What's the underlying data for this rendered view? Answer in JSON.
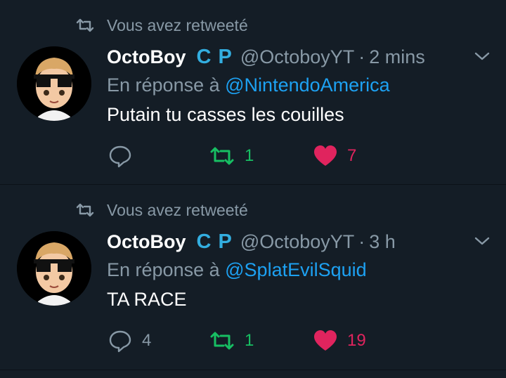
{
  "colors": {
    "background": "#141d26",
    "secondary_text": "#8899a6",
    "mention": "#1da1f2",
    "badge": "#33aee0",
    "retweet": "#17bf63",
    "like": "#e0245e"
  },
  "tweets": [
    {
      "retweet_context": "Vous avez retweeté",
      "author_name": "OctoBoy",
      "badge_c": "C",
      "badge_p": "P",
      "handle": "@OctoboyYT",
      "separator": "·",
      "time": "2 mins",
      "reply_prefix": "En réponse à",
      "reply_to": "@NintendoAmerica",
      "text": "Putain tu casses les couilles",
      "reply_count": "",
      "retweet_count": "1",
      "like_count": "7",
      "icons": [
        "retweet-icon",
        "avatar",
        "chevron-down-icon",
        "reply-icon",
        "retweet-icon",
        "heart-icon"
      ]
    },
    {
      "retweet_context": "Vous avez retweeté",
      "author_name": "OctoBoy",
      "badge_c": "C",
      "badge_p": "P",
      "handle": "@OctoboyYT",
      "separator": "·",
      "time": "3 h",
      "reply_prefix": "En réponse à",
      "reply_to": "@SplatEvilSquid",
      "text": "TA RACE",
      "reply_count": "4",
      "retweet_count": "1",
      "like_count": "19",
      "icons": [
        "retweet-icon",
        "avatar",
        "chevron-down-icon",
        "reply-icon",
        "retweet-icon",
        "heart-icon"
      ]
    }
  ]
}
